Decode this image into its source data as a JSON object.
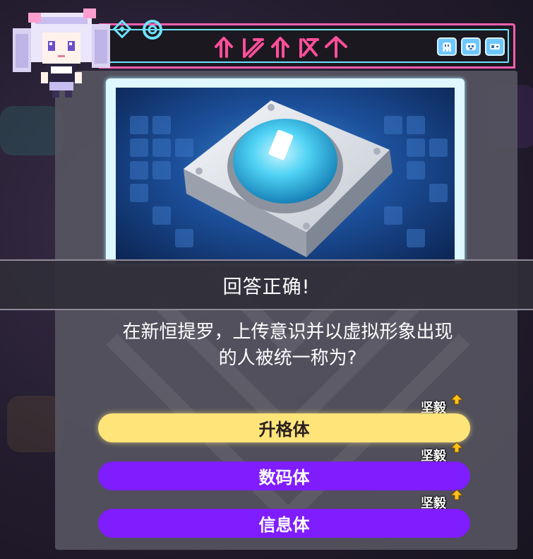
{
  "banner": {
    "text": "回答正确!"
  },
  "question": {
    "line1": "在新恒提罗，上传意识并以虚拟形象出现",
    "line2": "的人被统一称为?"
  },
  "answers": [
    {
      "label": "升格体",
      "tag": "坚毅",
      "state": "selected"
    },
    {
      "label": "数码体",
      "tag": "坚毅",
      "state": "normal"
    },
    {
      "label": "信息体",
      "tag": "坚毅",
      "state": "normal"
    }
  ],
  "icons": {
    "header_left": [
      "diamond-icon",
      "ring-icon"
    ],
    "emblems": [
      "ghost-emblem-icon",
      "critter-emblem-icon",
      "pixel-emblem-icon"
    ],
    "tag_indicator": "up-arrow-icon"
  },
  "colors": {
    "accent_pink": "#ff5fb0",
    "accent_cyan": "#6ee3ff",
    "selected_answer": "#ffe47a",
    "answer": "#7f1dff",
    "tag_arrow": "#ffc21a"
  }
}
